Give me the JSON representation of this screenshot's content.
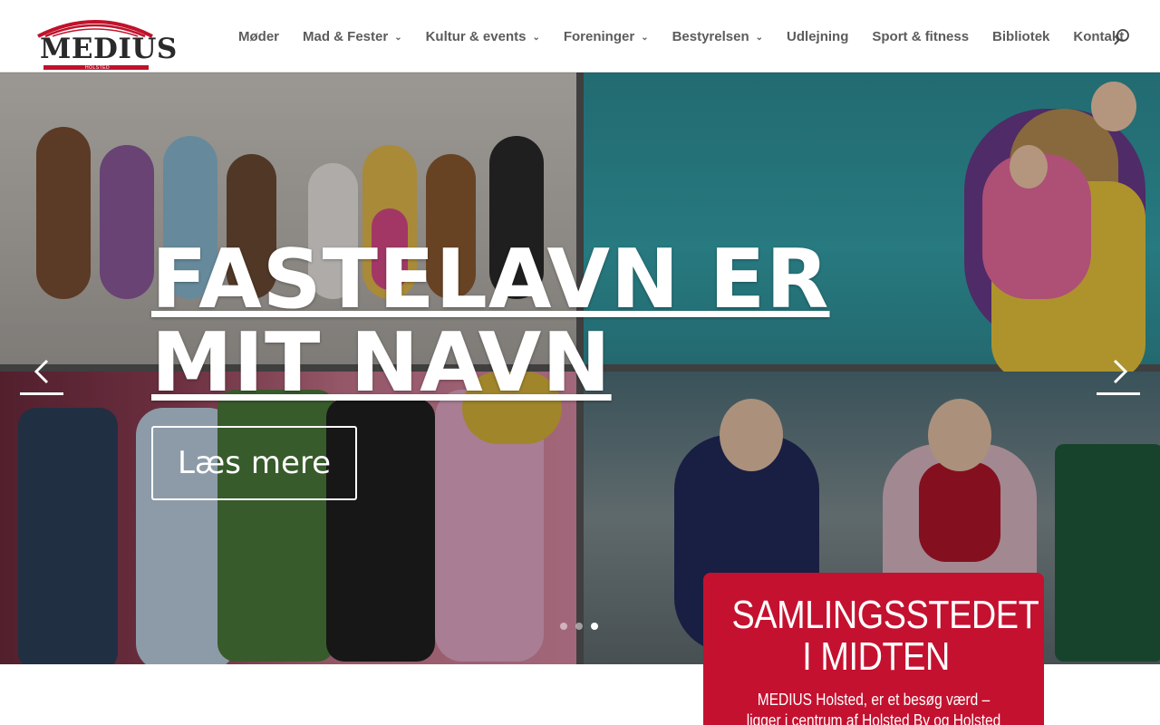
{
  "header": {
    "logo": {
      "text": "MEDIUS",
      "subtext": "HOLSTED",
      "accent_color": "#c0122b"
    },
    "nav": [
      {
        "label": "Møder",
        "has_dropdown": false
      },
      {
        "label": "Mad & Fester",
        "has_dropdown": true
      },
      {
        "label": "Kultur & events",
        "has_dropdown": true
      },
      {
        "label": "Foreninger",
        "has_dropdown": true
      },
      {
        "label": "Bestyrelsen",
        "has_dropdown": true
      },
      {
        "label": "Udlejning",
        "has_dropdown": false
      },
      {
        "label": "Sport & fitness",
        "has_dropdown": false
      },
      {
        "label": "Bibliotek",
        "has_dropdown": false
      },
      {
        "label": "Kontakt",
        "has_dropdown": false
      }
    ],
    "search_icon": "search-icon"
  },
  "hero": {
    "title": "FASTELAVN ER MIT NAVN",
    "button_label": "Læs mere",
    "slides_total": 3,
    "active_slide": 3,
    "prev_icon": "chevron-left-icon",
    "next_icon": "chevron-right-icon"
  },
  "card": {
    "title_line1": "SAMLINGSSTEDET",
    "title_line2": "I MIDTEN",
    "text": "MEDIUS Holsted, er et besøg værd – ligger i centrum af Holsted By og Holsted Station",
    "color": "#c4112f"
  }
}
